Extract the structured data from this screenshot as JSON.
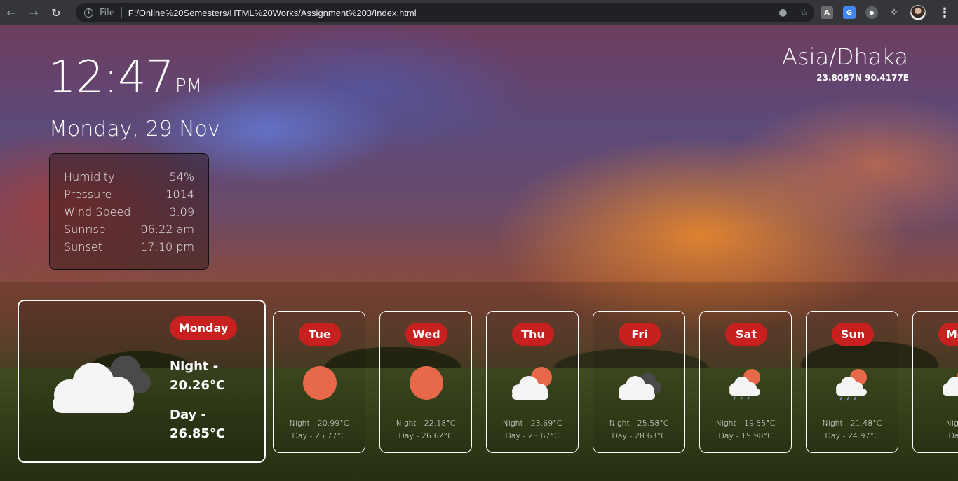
{
  "browser": {
    "scheme": "File",
    "url": "F:/Online%20Semesters/HTML%20Works/Assignment%203/Index.html"
  },
  "clock": {
    "time": "12:47",
    "ampm": "PM",
    "date": "Monday, 29 Nov"
  },
  "details": [
    {
      "label": "Humidity",
      "value": "54%"
    },
    {
      "label": "Pressure",
      "value": "1014"
    },
    {
      "label": "Wind Speed",
      "value": "3.09"
    },
    {
      "label": "Sunrise",
      "value": "06:22 am"
    },
    {
      "label": "Sunset",
      "value": "17:10 pm"
    }
  ],
  "location": {
    "timezone": "Asia/Dhaka",
    "coords": "23.8087N 90.4177E"
  },
  "today": {
    "day": "Monday",
    "night": "Night - 20.26°C",
    "day_temp": "Day - 26.85°C",
    "icon": "cloudy-icon"
  },
  "forecast": [
    {
      "day": "Tue",
      "icon": "sun-icon",
      "night": "Night - 20.99°C",
      "day_temp": "Day - 25.77°C"
    },
    {
      "day": "Wed",
      "icon": "sun-icon",
      "night": "Night - 22.18°C",
      "day_temp": "Day - 26.62°C"
    },
    {
      "day": "Thu",
      "icon": "partly-cloudy-icon",
      "night": "Night - 23.69°C",
      "day_temp": "Day - 28.67°C"
    },
    {
      "day": "Fri",
      "icon": "cloudy-icon",
      "night": "Night - 25.58°C",
      "day_temp": "Day - 28.63°C"
    },
    {
      "day": "Sat",
      "icon": "rain-icon",
      "night": "Night - 19.55°C",
      "day_temp": "Day - 19.98°C"
    },
    {
      "day": "Sun",
      "icon": "rain-icon",
      "night": "Night - 21.48°C",
      "day_temp": "Day - 24.97°C"
    },
    {
      "day": "Mon",
      "icon": "rain-icon",
      "night": "Night -",
      "day_temp": "Day -"
    }
  ],
  "colors": {
    "pill": "#c8201e",
    "sun": "#e8694a"
  }
}
